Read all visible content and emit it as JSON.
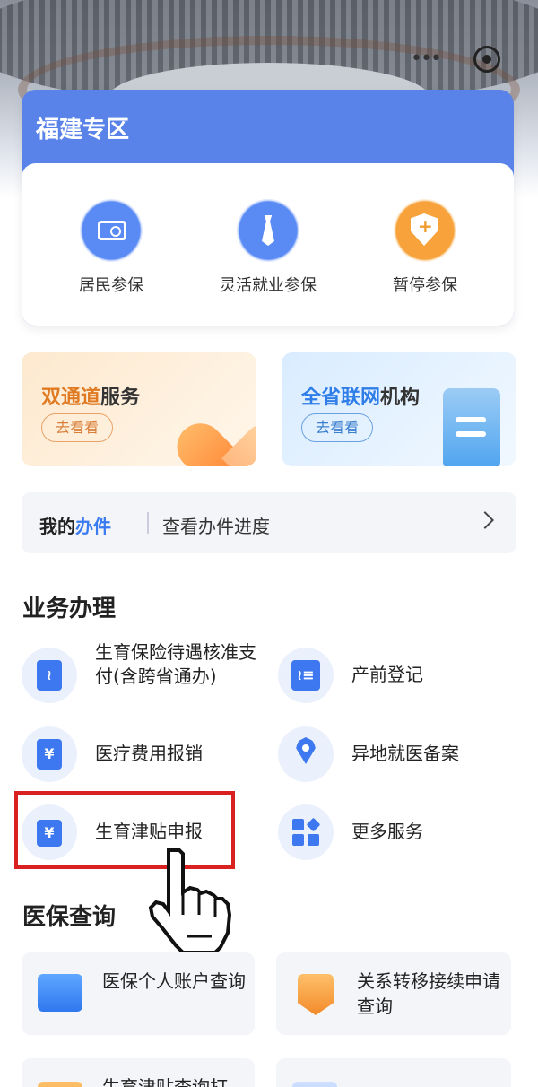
{
  "fujian": {
    "title": "福建专区",
    "items": [
      {
        "label": "居民参保",
        "icon": "id-card-icon"
      },
      {
        "label": "灵活就业参保",
        "icon": "tie-icon"
      },
      {
        "label": "暂停参保",
        "icon": "shield-minus-icon"
      }
    ]
  },
  "banners": [
    {
      "title_highlight": "双通道",
      "title_rest": "服务",
      "button": "去看看",
      "color": "#e07a22"
    },
    {
      "title_highlight": "全省联网",
      "title_rest": "机构",
      "button": "去看看",
      "color": "#2f7de8"
    }
  ],
  "my_tasks": {
    "title_plain": "我的",
    "title_highlight": "办件",
    "subtitle": "查看办件进度"
  },
  "business": {
    "title": "业务办理",
    "items": [
      {
        "label": "生育保险待遇核准支付(含跨省通办)"
      },
      {
        "label": "产前登记"
      },
      {
        "label": "医疗费用报销"
      },
      {
        "label": "异地就医备案"
      },
      {
        "label": "生育津贴申报"
      },
      {
        "label": "更多服务"
      }
    ]
  },
  "query": {
    "title": "医保查询",
    "items": [
      {
        "label": "医保个人账户查询"
      },
      {
        "label": "关系转移接续申请查询"
      },
      {
        "label": "生育津贴查询打"
      },
      {
        "label": ""
      }
    ]
  },
  "colors": {
    "accent": "#3d78f0",
    "highlight_box": "#d9211f"
  }
}
